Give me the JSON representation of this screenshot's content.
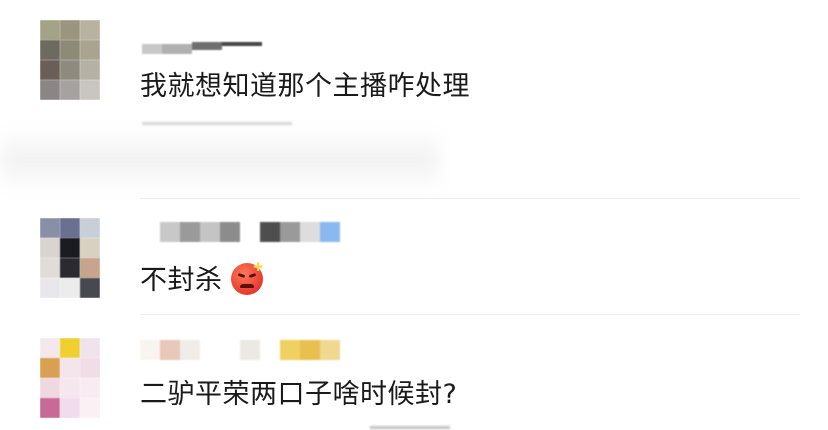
{
  "comments": [
    {
      "text": "我就想知道那个主播咋处理",
      "emoji": ""
    },
    {
      "text": "不封杀",
      "emoji": "angry-face-icon"
    },
    {
      "text": "二驴平荣两口子啥时候封?",
      "emoji": ""
    }
  ],
  "colors": {
    "text": "#1a1a1a",
    "divider": "#eeeeee",
    "emoji_red": "#e63b2e"
  }
}
